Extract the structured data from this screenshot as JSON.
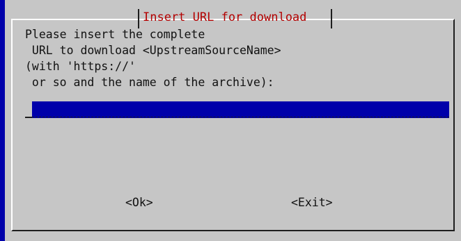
{
  "dialog": {
    "title": "Insert URL for download",
    "prompt_lines": [
      "Please insert the complete",
      " URL to download <UpstreamSourceName>",
      "(with 'https://'",
      " or so and the name of the archive):"
    ],
    "url_field": {
      "value": ""
    },
    "buttons": {
      "ok_label": "<Ok>",
      "exit_label": "<Exit>"
    }
  },
  "colors": {
    "background": "#0000aa",
    "dialog": "#c6c6c6",
    "title": "#b30000",
    "input_field": "#0000aa"
  }
}
